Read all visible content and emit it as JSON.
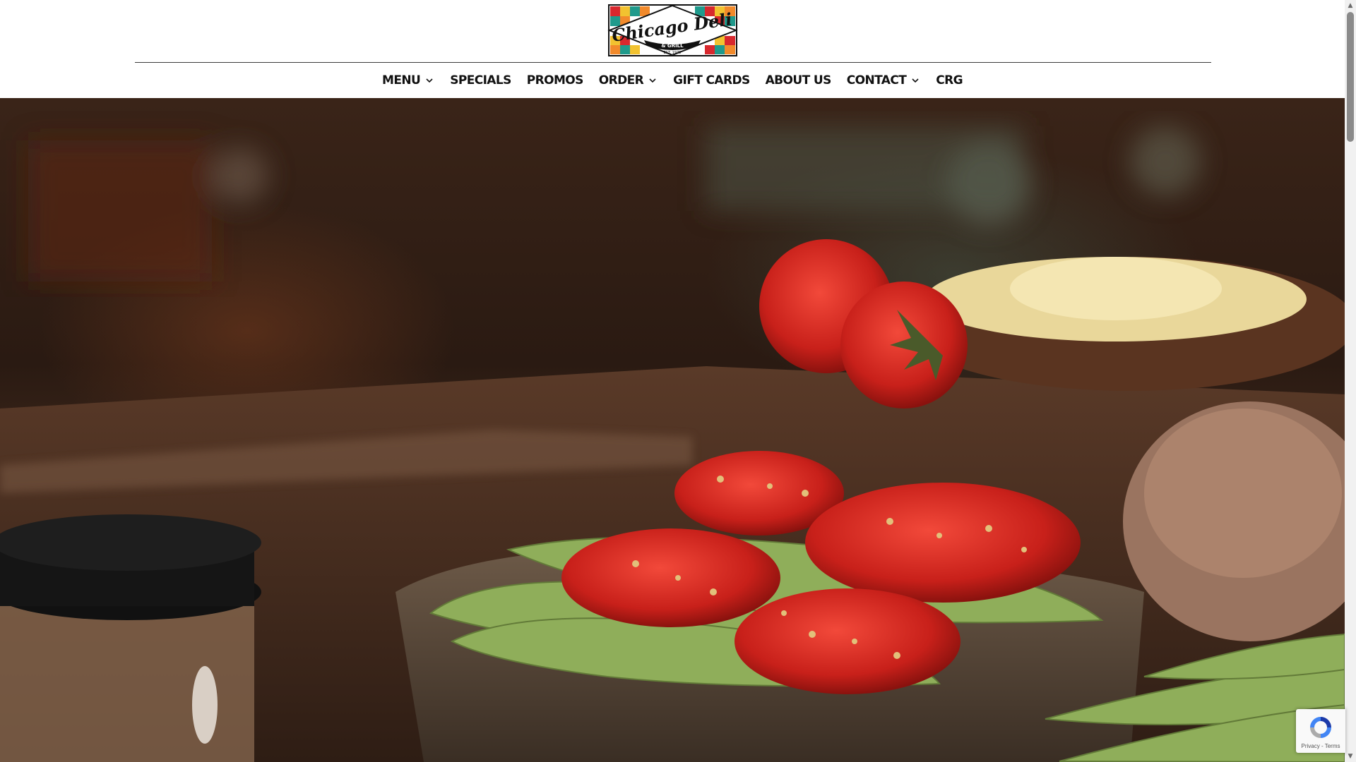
{
  "brand": {
    "name": "Chicago Deli",
    "sub": "& GRILL",
    "est": "EST. 1979"
  },
  "nav": {
    "items": [
      {
        "label": "MENU",
        "has_dropdown": true
      },
      {
        "label": "SPECIALS",
        "has_dropdown": false
      },
      {
        "label": "PROMOS",
        "has_dropdown": false
      },
      {
        "label": "ORDER",
        "has_dropdown": true
      },
      {
        "label": "GIFT CARDS",
        "has_dropdown": false
      },
      {
        "label": "ABOUT US",
        "has_dropdown": false
      },
      {
        "label": "CONTACT",
        "has_dropdown": true
      },
      {
        "label": "CRG",
        "has_dropdown": false
      }
    ]
  },
  "recaptcha": {
    "links": "Privacy - Terms"
  },
  "colors": {
    "nav_text": "#111111",
    "rule": "#3a3a3a",
    "logo_red": "#d8282e",
    "logo_orange": "#f28a2b",
    "logo_teal": "#1f9a8c",
    "logo_yellow": "#f2c230"
  }
}
